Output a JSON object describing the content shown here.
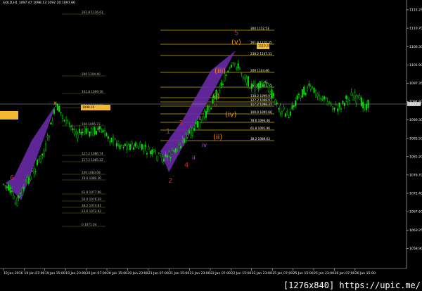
{
  "window": {
    "title": "GOLD,H1  1097.47 1098.13 1097.20 1097.60",
    "watermark": "[1276x840] https://upic.me/"
  },
  "colors": {
    "background": "#000000",
    "bull_candle": "#00e000",
    "wave_fill": "#6a2aa8",
    "fib_line": "#c8b000",
    "fib_line_dim": "#9a8a22",
    "wave_red": "#e02020",
    "wave_orange": "#ff8c00",
    "wave_purple": "#b060e0",
    "highlight_box": "#f2b830",
    "price_tag": "#c0c0c0"
  },
  "price_axis": {
    "ticks": [
      "1115.25",
      "1110.70",
      "1106.30",
      "1101.90",
      "1097.35",
      "1094.80",
      "1090.30",
      "1085.50",
      "1081.20",
      "1076.70",
      "1072.40",
      "1067.60",
      "1063.25",
      "1058.90"
    ],
    "current_price": "1097.60"
  },
  "time_axis": {
    "ticks": [
      "19 Jan 2016",
      "19 Jan 07:00",
      "19 Jan 15:00",
      "19 Jan 23:00",
      "20 Jan 07:00",
      "20 Jan 15:00",
      "20 Jan 23:00",
      "21 Jan 07:00",
      "21 Jan 15:00",
      "21 Jan 23:00",
      "22 Jan 07:00",
      "22 Jan 15:00",
      "22 Jan 23:00",
      "25 Jan 07:00",
      "25 Jan 15:00",
      "25 Jan 23:00",
      "26 Jan 07:00",
      "26 Jan 15:00"
    ]
  },
  "fib_sets": {
    "right_levels": [
      {
        "label": "300  1112.53",
        "style": "solid"
      },
      {
        "label": "261.8  1110.35",
        "style": "solid"
      },
      {
        "label": "238.2  1107.31",
        "style": "solid"
      },
      {
        "label": "200  1104.46",
        "style": "solid"
      },
      {
        "label": "161.8  1101.65",
        "style": "solid"
      },
      {
        "label": "138.2  1099.97",
        "style": "solid"
      },
      {
        "label": "127.2  1098.97",
        "style": "solid"
      },
      {
        "label": "117.2  1098.37",
        "style": "solid"
      },
      {
        "label": "100.0  1095.66",
        "style": "solid"
      },
      {
        "label": "78.6  1093.46",
        "style": "solid"
      },
      {
        "label": "61.8  1091.96",
        "style": "solid"
      },
      {
        "label": "38.2  1089.63",
        "style": "solid"
      }
    ],
    "left_levels": [
      {
        "label": "261.8  1116.61"
      },
      {
        "label": "200  1104.46"
      },
      {
        "label": "161.8  1099.36"
      },
      {
        "label": "138.2  1096.18"
      },
      {
        "label": "100  1095.73"
      },
      {
        "label": "127.2  1086.74"
      },
      {
        "label": "117.2  1085.32"
      },
      {
        "label": "100  1083.08"
      },
      {
        "label": "78.6  1080.30"
      },
      {
        "label": "61.8  1077.96"
      },
      {
        "label": "50.0  1076.39"
      },
      {
        "label": "38.2  1074.81"
      },
      {
        "label": "23.6  1072.92"
      },
      {
        "label": "0  1071.04"
      }
    ]
  },
  "price_tags": [
    {
      "label": "1110.35"
    },
    {
      "label": "1098.10"
    }
  ],
  "wave_labels": {
    "w5": "5",
    "w6": "6",
    "wx": "x",
    "w1": "1",
    "w2": "2",
    "w3": "3",
    "w4": "4",
    "sub_v": "(v)",
    "sub_iii": "(iii)",
    "sub_i": "(i)",
    "sub_iv": "(iv)",
    "sub_ii": "(ii)",
    "min_v": "v",
    "min_iii": "iii",
    "min_iv": "iv",
    "min_ii": "ii"
  }
}
